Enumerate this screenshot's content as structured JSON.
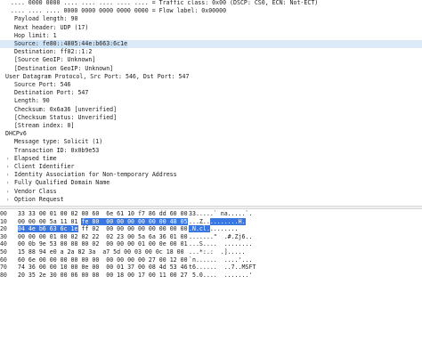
{
  "details": [
    {
      "text": "   .... 0000 0000 .... .... .... .... .... = Traffic class: 0x00 (DSCP: CS0, ECN: Not-ECT)",
      "indent": 0,
      "arrow": ""
    },
    {
      "text": "   .... .... .... 0000 0000 0000 0000 0000 = Flow label: 0x00000",
      "indent": 0,
      "arrow": ""
    },
    {
      "text": "Payload length: 90",
      "indent": 16,
      "arrow": ""
    },
    {
      "text": "Next header: UDP (17)",
      "indent": 16,
      "arrow": ""
    },
    {
      "text": "Hop limit: 1",
      "indent": 16,
      "arrow": ""
    },
    {
      "text": "Source: fe80::4805:44e:b663:6c1e",
      "indent": 16,
      "arrow": "",
      "selected": true
    },
    {
      "text": "Destination: ff02::1:2",
      "indent": 16,
      "arrow": ""
    },
    {
      "text": "[Source GeoIP: Unknown]",
      "indent": 16,
      "arrow": ""
    },
    {
      "text": "[Destination GeoIP: Unknown]",
      "indent": 16,
      "arrow": ""
    },
    {
      "text": "User Datagram Protocol, Src Port: 546, Dst Port: 547",
      "indent": 6,
      "arrow": ""
    },
    {
      "text": "Source Port: 546",
      "indent": 16,
      "arrow": ""
    },
    {
      "text": "Destination Port: 547",
      "indent": 16,
      "arrow": ""
    },
    {
      "text": "Length: 90",
      "indent": 16,
      "arrow": ""
    },
    {
      "text": "Checksum: 0x6a36 [unverified]",
      "indent": 16,
      "arrow": ""
    },
    {
      "text": "[Checksum Status: Unverified]",
      "indent": 16,
      "arrow": ""
    },
    {
      "text": "[Stream index: 0]",
      "indent": 16,
      "arrow": ""
    },
    {
      "text": "DHCPv6",
      "indent": 6,
      "arrow": ""
    },
    {
      "text": "Message type: Solicit (1)",
      "indent": 16,
      "arrow": ""
    },
    {
      "text": "Transaction ID: 0x0b9e53",
      "indent": 16,
      "arrow": ""
    },
    {
      "text": "Elapsed time",
      "indent": 16,
      "arrow": ">"
    },
    {
      "text": "Client Identifier",
      "indent": 16,
      "arrow": ">"
    },
    {
      "text": "Identity Association for Non-temporary Address",
      "indent": 16,
      "arrow": ">"
    },
    {
      "text": "Fully Qualified Domain Name",
      "indent": 16,
      "arrow": ">"
    },
    {
      "text": "Vendor Class",
      "indent": 16,
      "arrow": ">"
    },
    {
      "text": "Option Request",
      "indent": 16,
      "arrow": ">"
    }
  ],
  "bytes": [
    {
      "offset": "0000",
      "hex_pre": "33 33 00 01 00 02 00 60  6e 61 10 f7 86 dd 60 00",
      "hex_hl": "",
      "hex_post": "",
      "ascii_pre": "33.....` na.....`.",
      "ascii_hl": "",
      "ascii_post": ""
    },
    {
      "offset": "0010",
      "hex_pre": "00 00 00 5a 11 01 ",
      "hex_hl": "fe 80  00 00 00 00 00 00 48 05",
      "hex_post": "",
      "ascii_pre": "...Z..",
      "ascii_hl": "........H.",
      "ascii_post": ""
    },
    {
      "offset": "0020",
      "hex_pre": "",
      "hex_hl": "04 4e b6 63 6c 1e",
      "hex_post": " ff 02  00 00 00 00 00 00 00 00",
      "ascii_pre": "",
      "ascii_hl": ".N.cl.",
      "ascii_post": "........"
    },
    {
      "offset": "0030",
      "hex_pre": "00 00 00 01 00 02 02 22  02 23 00 5a 6a 36 01 00",
      "hex_hl": "",
      "hex_post": "",
      "ascii_pre": ".......\"  .#.Zj6..",
      "ascii_hl": "",
      "ascii_post": ""
    },
    {
      "offset": "0040",
      "hex_pre": "00 0b 9e 53 00 08 00 02  00 00 00 01 00 0e 00 01",
      "hex_hl": "",
      "hex_post": "",
      "ascii_pre": "...S....  ........",
      "ascii_hl": "",
      "ascii_post": ""
    },
    {
      "offset": "0050",
      "hex_pre": "15 88 94 e0 a 2a 82 3a  a7 5d 00 03 00 0c 18 00",
      "hex_hl": "",
      "hex_post": "",
      "ascii_pre": "...*:.:  .].....",
      "ascii_hl": "",
      "ascii_post": ""
    },
    {
      "offset": "0060",
      "hex_pre": "60 6e 00 00 00 00 00 00  00 00 00 00 27 00 12 00",
      "hex_hl": "",
      "hex_post": "",
      "ascii_pre": "`n......  ....'...",
      "ascii_hl": "",
      "ascii_post": ""
    },
    {
      "offset": "0070",
      "hex_pre": "74 36 00 00 10 00 0e 00  00 01 37 00 08 4d 53 46",
      "hex_hl": "",
      "hex_post": "",
      "ascii_pre": "t6......  ..7..MSFT",
      "ascii_hl": "",
      "ascii_post": ""
    },
    {
      "offset": "0080",
      "hex_pre": "20 35 2e 30 00 06 00 08  00 18 00 17 00 11 00 27",
      "hex_hl": "",
      "hex_post": "",
      "ascii_pre": " 5.0....  .......'",
      "ascii_hl": "",
      "ascii_post": ""
    }
  ]
}
